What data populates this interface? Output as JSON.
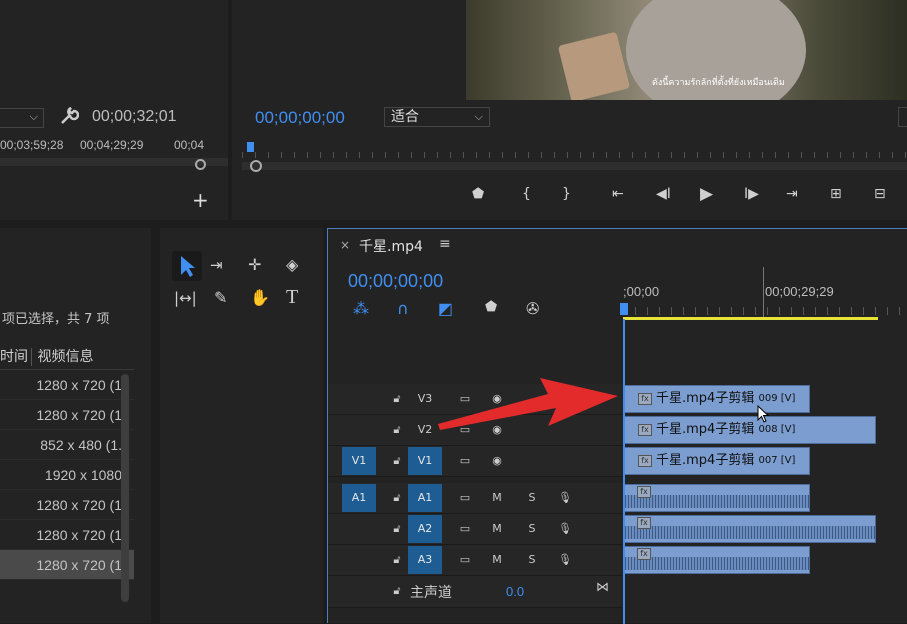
{
  "source_monitor": {
    "duration": "00;00;32;01",
    "ruler_labels": [
      "00;03;59;28",
      "00;04;29;29",
      "00;04"
    ]
  },
  "program_monitor": {
    "timecode": "00;00;00;00",
    "fit_label": "适合",
    "subtitle_text": "ดังนี้ความรักลักที่ตั้งที่ยังเหมือนเดิม"
  },
  "project_panel": {
    "selection_text": "项已选择，共 7 项",
    "col_time": "时间",
    "col_video_info": "视频信息",
    "rows": [
      "1280 x 720 (1",
      "1280 x 720 (1",
      "852 x 480 (1.",
      "1920 x 1080",
      "1280 x 720 (1",
      "1280 x 720 (1",
      "1280 x 720 (1"
    ]
  },
  "timeline": {
    "tab_title": "千星.mp4",
    "close": "×",
    "menu": "≡",
    "timecode": "00;00;00;00",
    "ruler_start": ";00;00",
    "ruler_mid": "00;00;29;29",
    "tracks": {
      "v3": "V3",
      "v2": "V2",
      "v1": "V1",
      "v1_src": "V1",
      "a1": "A1",
      "a1_src": "A1",
      "a2": "A2",
      "a3": "A3",
      "m": "M",
      "s": "S"
    },
    "master_label": "主声道",
    "master_value": "0.0",
    "clips": {
      "c009": "千星.mp4子剪辑",
      "c009_tag": "009 [V]",
      "c008": "千星.mp4子剪辑",
      "c008_tag": "008 [V]",
      "c007": "千星.mp4子剪辑",
      "c007_tag": "007 [V]"
    },
    "fx": "fx"
  },
  "colors": {
    "accent": "#3f8ef0",
    "clip": "#7b9dd0",
    "arrow": "#e32b2b",
    "track_target": "#1d5d93"
  }
}
